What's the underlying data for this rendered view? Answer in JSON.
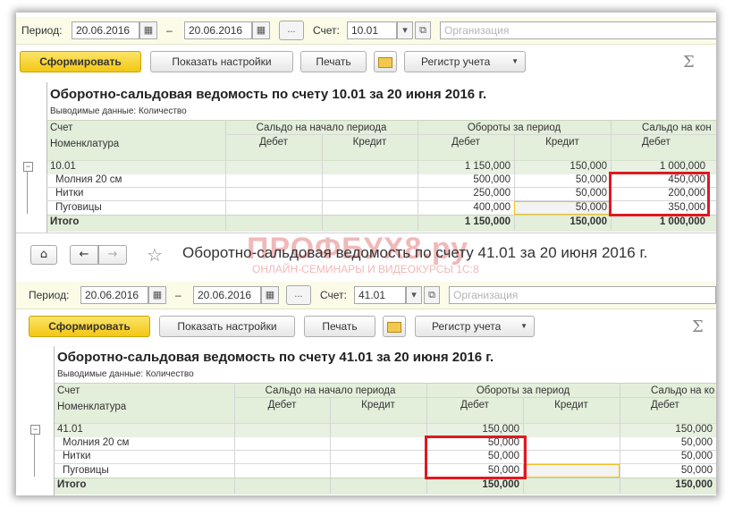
{
  "colors": {
    "accent_yellow": "#f3c713",
    "header_green": "#e3eedb",
    "subtotal_green": "#e8f1e2",
    "highlight_red": "#e0181f",
    "params_bg": "#fbfbe8"
  },
  "top": {
    "params": {
      "period_label": "Период:",
      "date_from": "20.06.2016",
      "dash": "–",
      "date_to": "20.06.2016",
      "dots": "...",
      "account_label": "Счет:",
      "account_value": "10.01",
      "org_placeholder": "Организация"
    },
    "toolbar": {
      "generate": "Сформировать",
      "show_settings": "Показать настройки",
      "print": "Печать",
      "register": "Регистр учета",
      "sigma": "Σ"
    },
    "report": {
      "title": "Оборотно-сальдовая ведомость по счету 10.01 за 20 июня 2016 г.",
      "subtitle": "Выводимые данные:  Количество",
      "headers": {
        "account": "Счет",
        "nomenclature": "Номенклатура",
        "opening": "Сальдо на начало периода",
        "turnover": "Обороты за период",
        "closing": "Сальдо на кон",
        "debit": "Дебет",
        "credit": "Кредит"
      },
      "group_row": {
        "name": "10.01",
        "turnover_debit": "1 150,000",
        "turnover_credit": "150,000",
        "closing_debit": "1 000,000"
      },
      "rows": [
        {
          "name": "Молния 20 см",
          "turnover_debit": "500,000",
          "turnover_credit": "50,000",
          "closing_debit": "450,000"
        },
        {
          "name": "Нитки",
          "turnover_debit": "250,000",
          "turnover_credit": "50,000",
          "closing_debit": "200,000"
        },
        {
          "name": "Пуговицы",
          "turnover_debit": "400,000",
          "turnover_credit": "50,000",
          "closing_debit": "350,000"
        }
      ],
      "total_row": {
        "name": "Итого",
        "turnover_debit": "1 150,000",
        "turnover_credit": "150,000",
        "closing_debit": "1 000,000"
      }
    }
  },
  "bottom": {
    "nav": {
      "title": "Оборотно-сальдовая ведомость по счету 41.01 за 20 июня 2016 г.",
      "watermark_logo": "ПРОФБУХ8.ру",
      "watermark_tagline": "ОНЛАЙН-СЕМИНАРЫ И ВИДЕОКУРСЫ 1С:8"
    },
    "params": {
      "period_label": "Период:",
      "date_from": "20.06.2016",
      "dash": "–",
      "date_to": "20.06.2016",
      "dots": "...",
      "account_label": "Счет:",
      "account_value": "41.01",
      "org_placeholder": "Организация"
    },
    "toolbar": {
      "generate": "Сформировать",
      "show_settings": "Показать настройки",
      "print": "Печать",
      "register": "Регистр учета",
      "sigma": "Σ"
    },
    "report": {
      "title": "Оборотно-сальдовая ведомость по счету 41.01 за 20 июня 2016 г.",
      "subtitle": "Выводимые данные:  Количество",
      "headers": {
        "account": "Счет",
        "nomenclature": "Номенклатура",
        "opening": "Сальдо на начало периода",
        "turnover": "Обороты за период",
        "closing": "Сальдо на ко",
        "debit": "Дебет",
        "credit": "Кредит"
      },
      "group_row": {
        "name": "41.01",
        "turnover_debit": "150,000",
        "closing_debit": "150,000"
      },
      "rows": [
        {
          "name": "Молния 20 см",
          "turnover_debit": "50,000",
          "closing_debit": "50,000"
        },
        {
          "name": "Нитки",
          "turnover_debit": "50,000",
          "closing_debit": "50,000"
        },
        {
          "name": "Пуговицы",
          "turnover_debit": "50,000",
          "closing_debit": "50,000"
        }
      ],
      "total_row": {
        "name": "Итого",
        "turnover_debit": "150,000",
        "closing_debit": "150,000"
      }
    }
  }
}
